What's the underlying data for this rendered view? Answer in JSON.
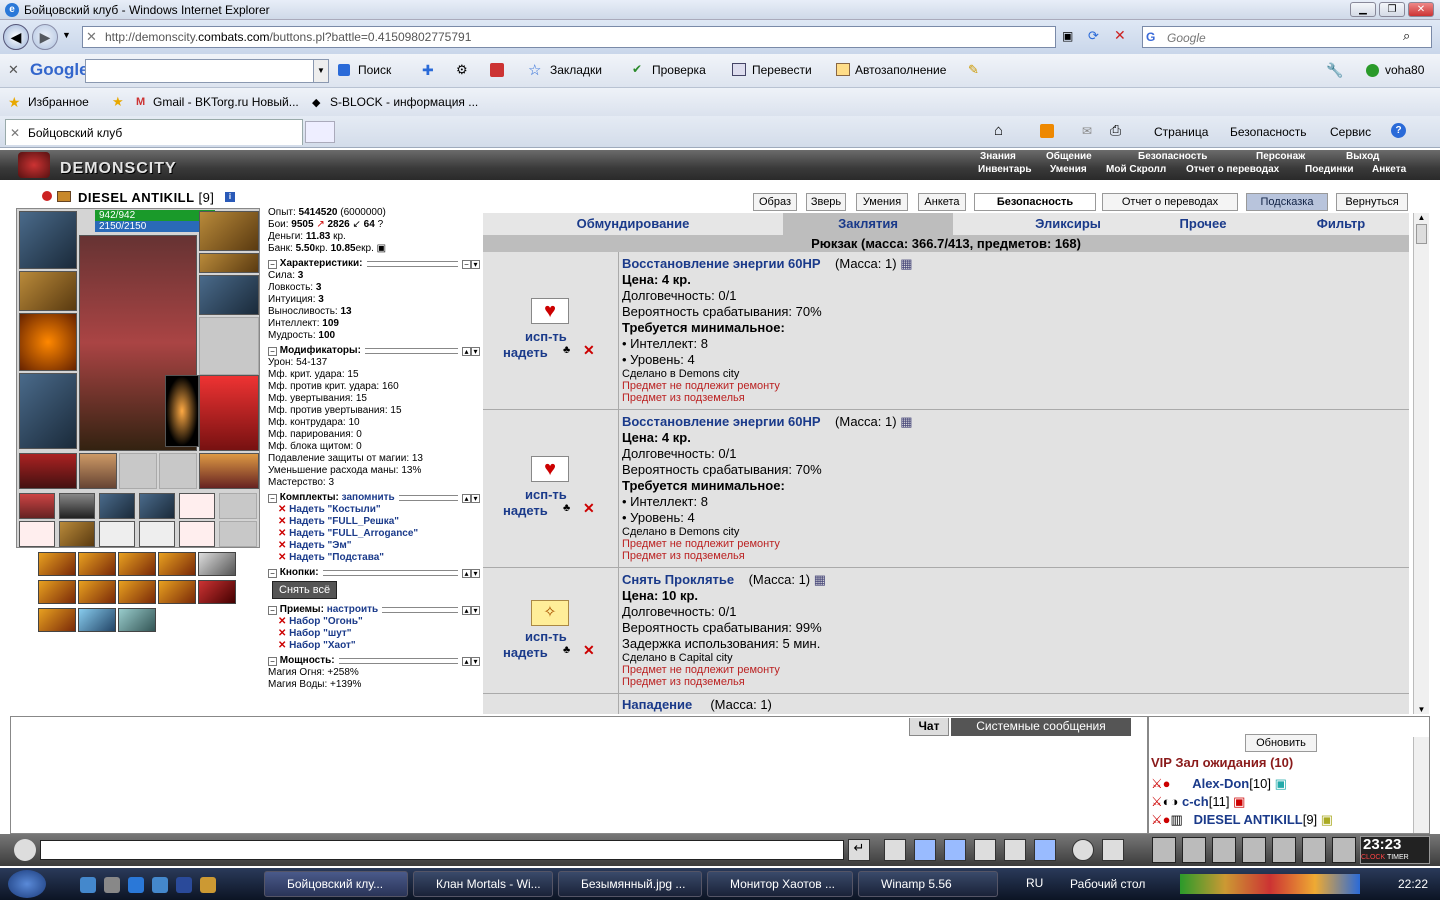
{
  "window": {
    "title": "Бойцовский клуб - Windows Internet Explorer"
  },
  "address": {
    "url_prefix": "http://demonscity.",
    "url_domain": "combats.com",
    "url_path": "/buttons.pl?battle=0.41509802775791",
    "search_placeholder": "Google"
  },
  "google_toolbar": {
    "logo": "Google",
    "search": "Поиск",
    "bookmarks": "Закладки",
    "check": "Проверка",
    "translate": "Перевести",
    "autofill": "Автозаполнение",
    "user": "voha80"
  },
  "favorites": {
    "label": "Избранное",
    "links": [
      "Gmail - BKTorg.ru Новый...",
      "S-BLOCK - информация ..."
    ]
  },
  "tab": {
    "title": "Бойцовский клуб"
  },
  "commands": {
    "page": "Страница",
    "safety": "Безопасность",
    "service": "Сервис"
  },
  "game_menu": {
    "logo": "DEMONSCITY",
    "row1": [
      "Знания",
      "Общение",
      "Безопасность",
      "Персонаж",
      "Выход"
    ],
    "row2": [
      "Инвентарь",
      "Умения",
      "Мой Скролл",
      "Отчет о переводах",
      "Поединки",
      "Анкета"
    ]
  },
  "character": {
    "name": "DIESEL ANTIKILL",
    "level": "[9]",
    "hp": "942/942",
    "mp": "2150/2150"
  },
  "stats": {
    "exp_label": "Опыт:",
    "exp": "5414520",
    "exp_next": "(6000000)",
    "battles_label": "Бои:",
    "battles_win": "9505",
    "battles_lose": "2826",
    "battles_draw": "64",
    "money_label": "Деньги:",
    "money": "11.83",
    "money_unit": "кр.",
    "bank_label": "Банк:",
    "bank": "5.50",
    "bank_unit": "кр.",
    "bank2": "10.85",
    "bank2_unit": "екр.",
    "char_title": "Характеристики:",
    "attrs": [
      [
        "Сила:",
        "3"
      ],
      [
        "Ловкость:",
        "3"
      ],
      [
        "Интуиция:",
        "3"
      ],
      [
        "Выносливость:",
        "13"
      ],
      [
        "Интеллект:",
        "109"
      ],
      [
        "Мудрость:",
        "100"
      ]
    ],
    "mod_title": "Модификаторы:",
    "mods": [
      "Урон: 54-137",
      "Мф. крит. удара: 15",
      "Мф. против крит. удара: 160",
      "Мф. увертывания: 15",
      "Мф. против увертывания: 15",
      "Мф. контрудара: 10",
      "Мф. парирования: 0",
      "Мф. блока щитом: 0",
      "Подавление защиты от магии: 13",
      "Уменьшение расхода маны: 13%",
      "Мастерство: 3"
    ],
    "sets_title": "Комплекты:",
    "sets_remember": "запомнить",
    "sets": [
      "Надеть \"Костыли\"",
      "Надеть \"FULL_Решка\"",
      "Надеть \"FULL_Arrogance\"",
      "Надеть \"Эм\"",
      "Надеть \"Подстава\""
    ],
    "buttons_title": "Кнопки:",
    "remove_all": "Снять всё",
    "tricks_title": "Приемы:",
    "tricks_setup": "настроить",
    "tricks": [
      "Набор \"Огонь\"",
      "Набор \"шут\"",
      "Набор \"Хаот\""
    ],
    "power_title": "Мощность:",
    "powers": [
      "Магия Огня: +258%",
      "Магия Воды: +139%"
    ]
  },
  "top_buttons": [
    "Образ",
    "Зверь",
    "Умения",
    "Анкета",
    "Безопасность",
    "Отчет о переводах",
    "Подсказка",
    "Вернуться"
  ],
  "inv_tabs": [
    "Обмундирование",
    "Заклятия",
    "Эликсиры",
    "Прочее",
    "Фильтр"
  ],
  "backpack": "Рюкзак (масса: 366.7/413, предметов: 168)",
  "item_actions": {
    "use": "исп-ть",
    "wear": "надеть"
  },
  "items": [
    {
      "name": "Восстановление энергии 60HP",
      "mass": "(Масса: 1)",
      "lines": [
        "Цена: 4 кр.",
        "Долговечность: 0/1",
        "Вероятность срабатывания: 70%",
        "Требуется минимальное:",
        "• Интеллект: 8",
        "• Уровень: 4"
      ],
      "made": "Сделано в Demons city",
      "note1": "Предмет не подлежит ремонту",
      "note2": "Предмет из подземелья"
    },
    {
      "name": "Восстановление энергии 60HP",
      "mass": "(Масса: 1)",
      "lines": [
        "Цена: 4 кр.",
        "Долговечность: 0/1",
        "Вероятность срабатывания: 70%",
        "Требуется минимальное:",
        "• Интеллект: 8",
        "• Уровень: 4"
      ],
      "made": "Сделано в Demons city",
      "note1": "Предмет не подлежит ремонту",
      "note2": "Предмет из подземелья"
    },
    {
      "name": "Снять Проклятье",
      "mass": "(Масса: 1)",
      "lines": [
        "Цена: 10 кр.",
        "Долговечность: 0/1",
        "Вероятность срабатывания: 99%",
        "Задержка использования: 5 мин."
      ],
      "made": "Сделано в Capital city",
      "note1": "Предмет не подлежит ремонту",
      "note2": "Предмет из подземелья"
    },
    {
      "name": "Нападение",
      "mass": "(Масса: 1)"
    }
  ],
  "chat": {
    "tab_chat": "Чат",
    "tab_system": "Системные сообщения"
  },
  "online": {
    "refresh": "Обновить",
    "room": "VIP Зал ожидания (10)",
    "players": [
      [
        "Alex-Don",
        "[10]"
      ],
      [
        "c-ch",
        "[11]"
      ],
      [
        "DIESEL ANTIKILL",
        "[9]"
      ]
    ]
  },
  "clock": {
    "time": "23:23",
    "label": "CLOCK",
    "timer": "TIMER"
  },
  "taskbar": {
    "tasks": [
      "Бойцовский клу...",
      "Клан Mortals - Wi...",
      "Безымянный.jpg ...",
      "Монитор Хаотов ...",
      "Winamp 5.56"
    ],
    "lang": "RU",
    "desktop": "Рабочий стол",
    "time": "22:22"
  }
}
